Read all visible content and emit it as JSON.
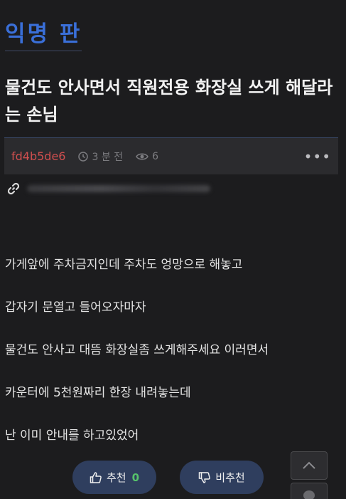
{
  "board": {
    "title": "익명 판"
  },
  "post": {
    "title": "물건도 안사면서 직원전용 화장실 쓰게 해달라는 손님",
    "author": "fd4b5de6",
    "time": "3 분 전",
    "views": "6",
    "content": [
      "가게앞에 주차금지인데 주차도 엉망으로 해놓고",
      "갑자기 문열고 들어오자마자",
      "물건도 안사고 대뜸 화장실좀 쓰게해주세요 이러면서",
      "카운터에 5천원짜리 한장 내려놓는데",
      "난 이미 안내를 하고있었어"
    ]
  },
  "votes": {
    "up_label": "추천",
    "up_count": "0",
    "down_label": "비추천"
  },
  "icons": [
    "clock-icon",
    "eye-icon",
    "more-icon",
    "link-icon",
    "thumbs-up-icon",
    "thumbs-down-icon",
    "chevron-up-icon"
  ],
  "colors": {
    "accent": "#3a6fd8",
    "author": "#d14f4f",
    "vote_count": "#56c26b",
    "button_bg": "#2f3e5e"
  }
}
